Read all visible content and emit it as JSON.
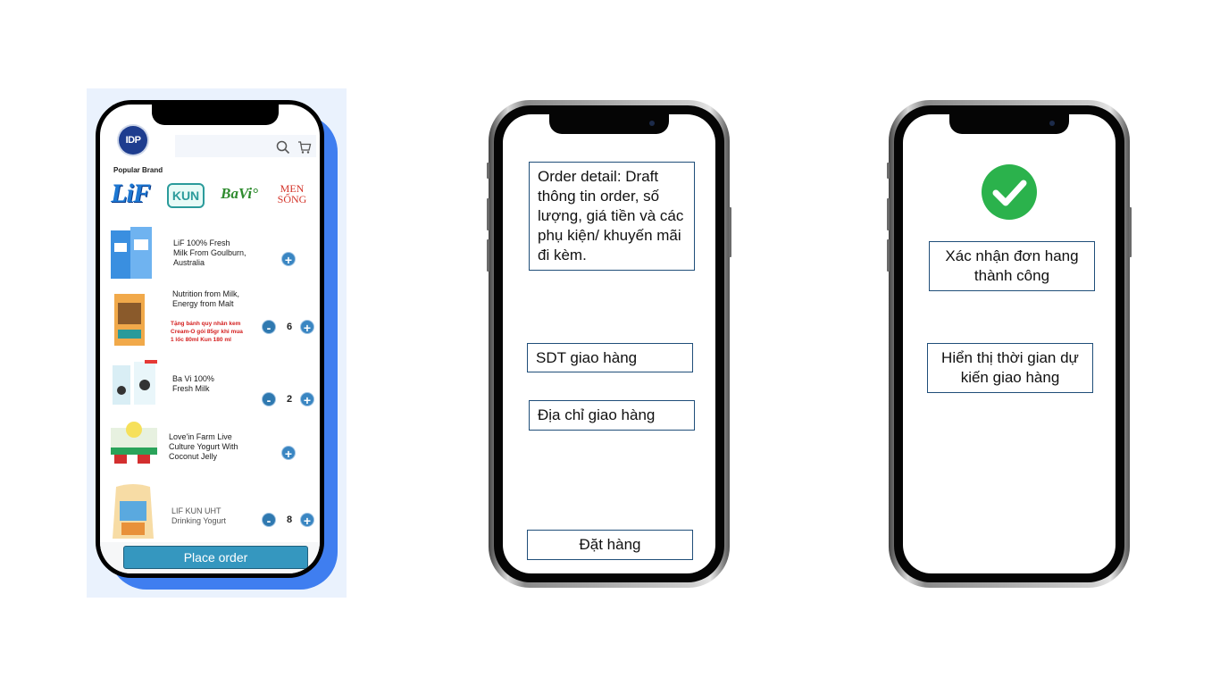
{
  "app_mockup": {
    "popular_brand_title": "Popular Brand",
    "brands": [
      {
        "name": "LiF",
        "icon": "lif-brand-logo"
      },
      {
        "name": "KUN",
        "icon": "kun-brand-logo"
      },
      {
        "name": "BaVi°",
        "icon": "bavi-brand-logo"
      },
      {
        "name": "MEN SỐNG",
        "icon": "men-song-brand-logo"
      }
    ],
    "products": [
      {
        "name_lines": [
          "LiF 100% Fresh",
          "Milk From Goulburn,",
          "Australia"
        ],
        "quantity": null
      },
      {
        "name_lines": [
          "Nutrition from Milk,",
          "Energy from Malt"
        ],
        "promo_lines": [
          "Tặng bánh quy nhân kem",
          "Cream-O gói 85gr khi mua",
          "1 lốc 80ml Kun 180 ml"
        ],
        "quantity": "6"
      },
      {
        "name_lines": [
          "Ba Vi 100%",
          "Fresh Milk"
        ],
        "quantity": "2"
      },
      {
        "name_lines": [
          "Love'in Farm Live",
          "Culture Yogurt With",
          "Coconut Jelly"
        ],
        "quantity": null
      },
      {
        "name_lines": [
          "LIF KUN UHT",
          "Drinking Yogurt"
        ],
        "quantity": "8"
      }
    ],
    "place_order_label": "Place order",
    "colors": {
      "accent": "#3597bf",
      "plus_button": "#3a86c2",
      "shadow": "#3f7ef0"
    }
  },
  "order_detail_phone": {
    "order_detail_text": "Order detail: Draft thông tin order, số lượng, giá tiền và các phụ kiện/ khuyến mãi đi kèm.",
    "phone_box": "SDT giao hàng",
    "address_box": "Địa chỉ giao hàng",
    "order_button": "Đặt hàng"
  },
  "confirmation_phone": {
    "check_icon": "check-circle-icon",
    "confirm_text": "Xác nhận đơn hang thành công",
    "delivery_time_text": "Hiển thị thời gian dự kiến giao hàng",
    "colors": {
      "check": "#2bb24c"
    }
  }
}
